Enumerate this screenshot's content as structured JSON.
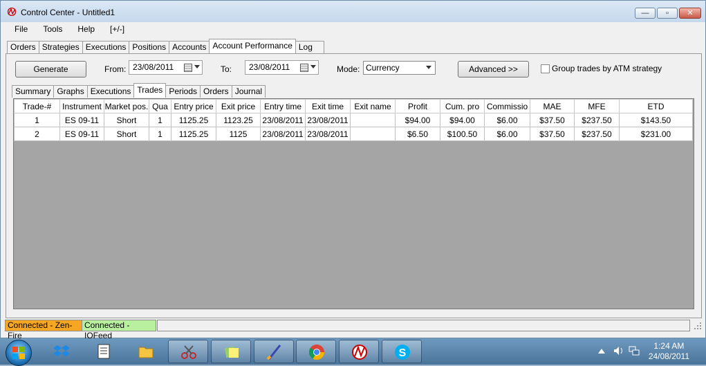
{
  "window": {
    "title": "Control Center - Untitled1"
  },
  "menu": [
    "File",
    "Tools",
    "Help",
    "[+/-]"
  ],
  "top_tabs": [
    "Orders",
    "Strategies",
    "Executions",
    "Positions",
    "Accounts",
    "Account Performance",
    "Log"
  ],
  "toolbar": {
    "generate_label": "Generate",
    "from_label": "From:",
    "from_value": "23/08/2011",
    "to_label": "To:",
    "to_value": "23/08/2011",
    "mode_label": "Mode:",
    "mode_value": "Currency",
    "advanced_label": "Advanced >>",
    "group_label": "Group trades by ATM strategy"
  },
  "sub_tabs": [
    "Summary",
    "Graphs",
    "Executions",
    "Trades",
    "Periods",
    "Orders",
    "Journal"
  ],
  "trades": {
    "columns": [
      "Trade-#",
      "Instrument",
      "Market pos.",
      "Qua",
      "Entry price",
      "Exit price",
      "Entry time",
      "Exit time",
      "Exit name",
      "Profit",
      "Cum. pro",
      "Commissio",
      "MAE",
      "MFE",
      "ETD"
    ],
    "rows": [
      [
        "1",
        "ES 09-11",
        "Short",
        "1",
        "1125.25",
        "1123.25",
        "23/08/2011",
        "23/08/2011",
        "",
        "$94.00",
        "$94.00",
        "$6.00",
        "$37.50",
        "$237.50",
        "$143.50"
      ],
      [
        "2",
        "ES 09-11",
        "Short",
        "1",
        "1125.25",
        "1125",
        "23/08/2011",
        "23/08/2011",
        "",
        "$6.50",
        "$100.50",
        "$6.00",
        "$37.50",
        "$237.50",
        "$231.00"
      ]
    ]
  },
  "status": {
    "conn1": "Connected - Zen-Fire",
    "conn2": "Connected - IQFeed"
  },
  "clock": {
    "time": "1:24 AM",
    "date": "24/08/2011"
  },
  "colors": {
    "conn1_bg": "#f5a623",
    "conn2_bg": "#b8f0a0"
  }
}
